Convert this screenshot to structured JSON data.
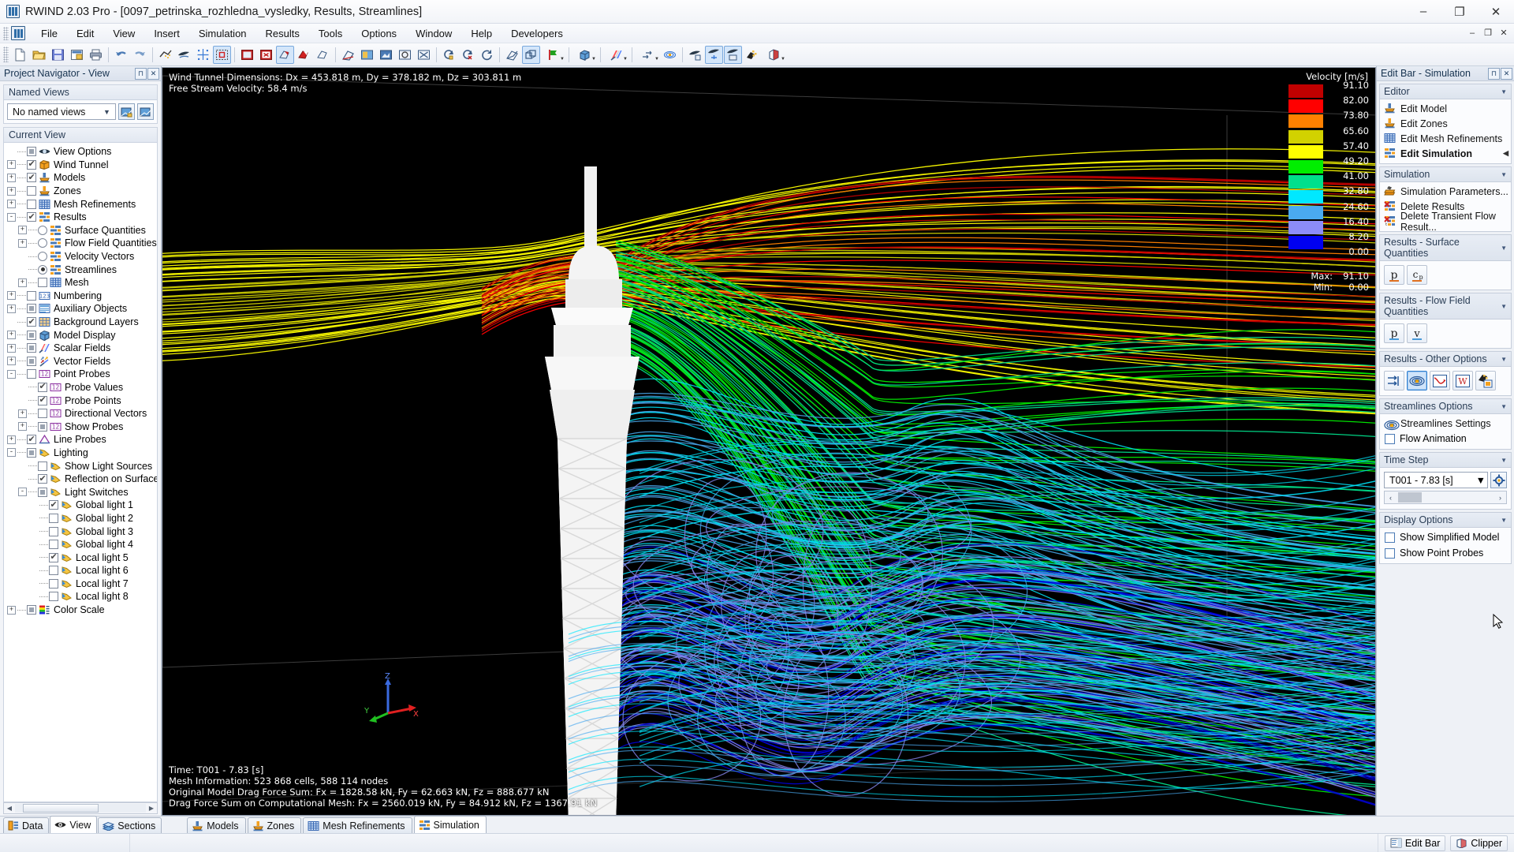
{
  "window": {
    "app_title": "RWIND 2.03 Pro - [0097_petrinska_rozhledna_vysledky, Results, Streamlines]",
    "app_icon": "rwind-icon",
    "minimize": "–",
    "maximize": "❐",
    "close": "✕",
    "doc_minimize": "–",
    "doc_maximize": "❐",
    "doc_close": "✕"
  },
  "menu": {
    "items": [
      {
        "label": "File"
      },
      {
        "label": "Edit"
      },
      {
        "label": "View"
      },
      {
        "label": "Insert"
      },
      {
        "label": "Simulation"
      },
      {
        "label": "Results"
      },
      {
        "label": "Tools"
      },
      {
        "label": "Options"
      },
      {
        "label": "Window"
      },
      {
        "label": "Help"
      },
      {
        "label": "Developers"
      }
    ]
  },
  "toolbar": {
    "buttons": [
      "new-icon",
      "open-icon",
      "save-icon",
      "save-as-icon",
      "print-icon",
      "undo-icon",
      "redo-icon",
      "mesh-icon",
      "wind-icon",
      "node-icon",
      "select-region-icon",
      "render-front-icon",
      "render-close-icon",
      "model-view-icon",
      "model-red-icon",
      "model-plain-icon",
      "axes-icon",
      "shade-icon",
      "render-blue-icon",
      "zoom-window-icon",
      "zoom-all-icon",
      "zoom-fit-icon",
      "rotate-left-icon",
      "rotate-right-icon",
      "rotate-free-icon",
      "isometric-icon",
      "wireframe-icon",
      "flag-icon",
      "cube-view-icon",
      "color-scale-icon",
      "vector-icon",
      "streamline-icon",
      "results-bottom-icon",
      "results-top-icon",
      "results-window-icon",
      "surface-result-icon",
      "section-cut-icon"
    ]
  },
  "left_panel": {
    "header": "Project Navigator - View",
    "header_buttons": [
      "pin-icon",
      "close-icon"
    ],
    "named_views": {
      "group_label": "Named Views",
      "selected": "No named views",
      "save_view_button": "save-view-icon",
      "new_view_button": "new-view-icon"
    },
    "current_view": {
      "group_label": "Current View"
    },
    "tree": [
      {
        "depth": 0,
        "expander": "none",
        "state": "gray",
        "stateType": "checkbox",
        "icon": "view-options-icon",
        "label": "View Options"
      },
      {
        "depth": 0,
        "expander": "+",
        "state": "checked",
        "stateType": "checkbox",
        "icon": "wind-tunnel-icon",
        "label": "Wind Tunnel"
      },
      {
        "depth": 0,
        "expander": "+",
        "state": "checked",
        "stateType": "checkbox",
        "icon": "models-icon",
        "label": "Models"
      },
      {
        "depth": 0,
        "expander": "+",
        "state": "unchecked",
        "stateType": "checkbox",
        "icon": "zones-icon",
        "label": "Zones"
      },
      {
        "depth": 0,
        "expander": "+",
        "state": "unchecked",
        "stateType": "checkbox",
        "icon": "mesh-grid-icon",
        "label": "Mesh Refinements"
      },
      {
        "depth": 0,
        "expander": "-",
        "state": "checked",
        "stateType": "checkbox",
        "icon": "results-icon",
        "label": "Results"
      },
      {
        "depth": 1,
        "expander": "+",
        "state": "unselected",
        "stateType": "radio",
        "icon": "results-icon",
        "label": "Surface Quantities"
      },
      {
        "depth": 1,
        "expander": "+",
        "state": "unselected",
        "stateType": "radio",
        "icon": "results-icon",
        "label": "Flow Field Quantities"
      },
      {
        "depth": 1,
        "expander": "none",
        "state": "unselected",
        "stateType": "radio",
        "icon": "results-icon",
        "label": "Velocity Vectors"
      },
      {
        "depth": 1,
        "expander": "none",
        "state": "selected",
        "stateType": "radio",
        "icon": "results-icon",
        "label": "Streamlines"
      },
      {
        "depth": 1,
        "expander": "+",
        "state": "unchecked",
        "stateType": "checkbox",
        "icon": "mesh-grid-icon",
        "label": "Mesh"
      },
      {
        "depth": 0,
        "expander": "+",
        "state": "unchecked",
        "stateType": "checkbox",
        "icon": "numbering-icon",
        "label": "Numbering"
      },
      {
        "depth": 0,
        "expander": "+",
        "state": "gray",
        "stateType": "checkbox",
        "icon": "aux-objects-icon",
        "label": "Auxiliary Objects"
      },
      {
        "depth": 0,
        "expander": "none",
        "state": "checked",
        "stateType": "checkbox",
        "icon": "background-layers-icon",
        "label": "Background Layers"
      },
      {
        "depth": 0,
        "expander": "+",
        "state": "gray",
        "stateType": "checkbox",
        "icon": "model-display-icon",
        "label": "Model Display"
      },
      {
        "depth": 0,
        "expander": "+",
        "state": "gray",
        "stateType": "checkbox",
        "icon": "scalar-fields-icon",
        "label": "Scalar Fields"
      },
      {
        "depth": 0,
        "expander": "+",
        "state": "gray",
        "stateType": "checkbox",
        "icon": "vector-fields-icon",
        "label": "Vector Fields"
      },
      {
        "depth": 0,
        "expander": "-",
        "state": "unchecked",
        "stateType": "checkbox",
        "icon": "point-probes-icon",
        "label": "Point Probes"
      },
      {
        "depth": 1,
        "expander": "none",
        "state": "checked",
        "stateType": "checkbox",
        "icon": "point-probes-icon",
        "label": "Probe Values"
      },
      {
        "depth": 1,
        "expander": "none",
        "state": "checked",
        "stateType": "checkbox",
        "icon": "point-probes-icon",
        "label": "Probe Points"
      },
      {
        "depth": 1,
        "expander": "+",
        "state": "unchecked",
        "stateType": "checkbox",
        "icon": "point-probes-icon",
        "label": "Directional Vectors"
      },
      {
        "depth": 1,
        "expander": "+",
        "state": "gray",
        "stateType": "checkbox",
        "icon": "point-probes-icon",
        "label": "Show Probes"
      },
      {
        "depth": 0,
        "expander": "+",
        "state": "checked",
        "stateType": "checkbox",
        "icon": "line-probes-icon",
        "label": "Line Probes"
      },
      {
        "depth": 0,
        "expander": "-",
        "state": "gray",
        "stateType": "checkbox",
        "icon": "lighting-icon",
        "label": "Lighting"
      },
      {
        "depth": 1,
        "expander": "none",
        "state": "unchecked",
        "stateType": "checkbox",
        "icon": "lighting-icon",
        "label": "Show Light Sources"
      },
      {
        "depth": 1,
        "expander": "none",
        "state": "checked",
        "stateType": "checkbox",
        "icon": "lighting-icon",
        "label": "Reflection on Surfaces"
      },
      {
        "depth": 1,
        "expander": "-",
        "state": "gray",
        "stateType": "checkbox",
        "icon": "lighting-icon",
        "label": "Light Switches"
      },
      {
        "depth": 2,
        "expander": "none",
        "state": "checked",
        "stateType": "checkbox",
        "icon": "lighting-icon",
        "label": "Global light 1"
      },
      {
        "depth": 2,
        "expander": "none",
        "state": "unchecked",
        "stateType": "checkbox",
        "icon": "lighting-icon",
        "label": "Global light 2"
      },
      {
        "depth": 2,
        "expander": "none",
        "state": "unchecked",
        "stateType": "checkbox",
        "icon": "lighting-icon",
        "label": "Global light 3"
      },
      {
        "depth": 2,
        "expander": "none",
        "state": "unchecked",
        "stateType": "checkbox",
        "icon": "lighting-icon",
        "label": "Global light 4"
      },
      {
        "depth": 2,
        "expander": "none",
        "state": "checked",
        "stateType": "checkbox",
        "icon": "lighting-icon",
        "label": "Local light 5"
      },
      {
        "depth": 2,
        "expander": "none",
        "state": "unchecked",
        "stateType": "checkbox",
        "icon": "lighting-icon",
        "label": "Local light 6"
      },
      {
        "depth": 2,
        "expander": "none",
        "state": "unchecked",
        "stateType": "checkbox",
        "icon": "lighting-icon",
        "label": "Local light 7"
      },
      {
        "depth": 2,
        "expander": "none",
        "state": "unchecked",
        "stateType": "checkbox",
        "icon": "lighting-icon",
        "label": "Local light 8"
      },
      {
        "depth": 0,
        "expander": "+",
        "state": "gray",
        "stateType": "checkbox",
        "icon": "color-scale-icon",
        "label": "Color Scale"
      }
    ],
    "tabs": [
      {
        "label": "Data",
        "icon": "data-icon",
        "active": false
      },
      {
        "label": "View",
        "icon": "eye-icon",
        "active": true
      },
      {
        "label": "Sections",
        "icon": "sections-icon",
        "active": false
      }
    ]
  },
  "viewport": {
    "top_overlay": "Wind Tunnel Dimensions: Dx = 453.818 m, Dy = 378.182 m, Dz = 303.811 m\nFree Stream Velocity: 58.4 m/s",
    "bottom_overlay": "Time: T001 - 7.83 [s]\nMesh Information: 523 868 cells, 588 114 nodes\nOriginal Model Drag Force Sum: Fx = 1828.58 kN, Fy = 62.663 kN, Fz = 888.677 kN\nDrag Force Sum on Computational Mesh: Fx = 2560.019 kN, Fy = 84.912 kN, Fz = 1367.91 kN",
    "axes": {
      "x": "X",
      "y": "Y",
      "z": "Z"
    }
  },
  "chart_data": {
    "type": "heatmap",
    "title": "Velocity [m/s]",
    "unit": "m/s",
    "quantity": "Velocity",
    "max_label": "Max:",
    "max_value": "91.10",
    "min_label": "Min:",
    "min_value": "0.00",
    "tick_labels": [
      "91.10",
      "82.00",
      "73.80",
      "65.60",
      "57.40",
      "49.20",
      "41.00",
      "32.80",
      "24.60",
      "16.40",
      "8.20",
      "0.00"
    ],
    "bands": [
      {
        "range": "82.00 - 91.10",
        "color": "#c00000"
      },
      {
        "range": "73.80 - 82.00",
        "color": "#ff0000"
      },
      {
        "range": "65.60 - 73.80",
        "color": "#ff8000"
      },
      {
        "range": "57.40 - 65.60",
        "color": "#d2d200"
      },
      {
        "range": "49.20 - 57.40",
        "color": "#ffff00"
      },
      {
        "range": "41.00 - 49.20",
        "color": "#00ee00"
      },
      {
        "range": "32.80 - 41.00",
        "color": "#00e08c"
      },
      {
        "range": "24.60 - 32.80",
        "color": "#00e8ff"
      },
      {
        "range": "16.40 - 24.60",
        "color": "#4aaaf0"
      },
      {
        "range": "8.20 - 16.40",
        "color": "#8c8cf8"
      },
      {
        "range": "0.00 - 8.20",
        "color": "#0000f0"
      }
    ]
  },
  "right_panel": {
    "header": "Edit Bar - Simulation",
    "header_buttons": [
      "pin-icon",
      "close-icon"
    ],
    "groups": [
      {
        "label": "Editor",
        "type": "menu",
        "items": [
          {
            "label": "Edit Model",
            "icon": "models-icon",
            "selected": false
          },
          {
            "label": "Edit Zones",
            "icon": "zones-icon",
            "selected": false
          },
          {
            "label": "Edit Mesh Refinements",
            "icon": "mesh-grid-icon",
            "selected": false
          },
          {
            "label": "Edit Simulation",
            "icon": "results-icon",
            "selected": true,
            "arrow": "◀"
          }
        ]
      },
      {
        "label": "Simulation",
        "type": "menu",
        "items": [
          {
            "label": "Simulation Parameters...",
            "icon": "sim-params-icon",
            "selected": false
          },
          {
            "label": "Delete Results",
            "icon": "delete-results-icon",
            "selected": false
          },
          {
            "label": "Delete Transient Flow Result...",
            "icon": "delete-transient-icon",
            "selected": false
          }
        ]
      },
      {
        "label": "Results - Surface Quantities",
        "type": "iconbar",
        "buttons": [
          {
            "icon": "pressure-p-icon",
            "label": "p",
            "active": false
          },
          {
            "icon": "pressure-cp-icon",
            "label": "cp",
            "active": false
          }
        ]
      },
      {
        "label": "Results - Flow Field Quantities",
        "type": "iconbar",
        "buttons": [
          {
            "icon": "flow-p-icon",
            "label": "p",
            "active": false
          },
          {
            "icon": "flow-v-icon",
            "label": "v",
            "active": false
          }
        ]
      },
      {
        "label": "Results - Other Options",
        "type": "iconbar",
        "buttons": [
          {
            "icon": "velocity-vectors-icon",
            "label": "",
            "active": false
          },
          {
            "icon": "streamlines-icon",
            "label": "",
            "active": true
          },
          {
            "icon": "convergence-icon",
            "label": "",
            "active": false
          },
          {
            "icon": "wind-report-icon",
            "label": "",
            "active": false
          },
          {
            "icon": "result-export-icon",
            "label": "",
            "active": false
          }
        ]
      },
      {
        "label": "Streamlines Options",
        "type": "menu",
        "items": [
          {
            "label": "Streamlines Settings",
            "icon": "streamlines-icon",
            "selected": false
          }
        ],
        "checkboxes": [
          {
            "label": "Flow Animation",
            "checked": false
          }
        ]
      },
      {
        "label": "Time Step",
        "type": "timestep",
        "selected": "T001 - 7.83 [s]",
        "settings_button": "gear-icon",
        "prev_label": "‹",
        "next_label": "›"
      },
      {
        "label": "Display Options",
        "type": "checkboxes",
        "checkboxes": [
          {
            "label": "Show Simplified Model",
            "checked": false
          },
          {
            "label": "Show Point Probes",
            "checked": false
          }
        ]
      }
    ]
  },
  "bottom_tabs": [
    {
      "label": "Models",
      "icon": "models-icon",
      "active": false
    },
    {
      "label": "Zones",
      "icon": "zones-icon",
      "active": false
    },
    {
      "label": "Mesh Refinements",
      "icon": "mesh-grid-icon",
      "active": false
    },
    {
      "label": "Simulation",
      "icon": "results-icon",
      "active": true
    }
  ],
  "status_tabs": [
    {
      "label": "Edit Bar",
      "icon": "edit-bar-icon"
    },
    {
      "label": "Clipper",
      "icon": "clipper-icon"
    }
  ],
  "colors": {
    "accent": "#2f7fd0",
    "panel_bg": "#eef1f6",
    "viewport_bg": "#000000",
    "selection": "#cfe4fa"
  }
}
